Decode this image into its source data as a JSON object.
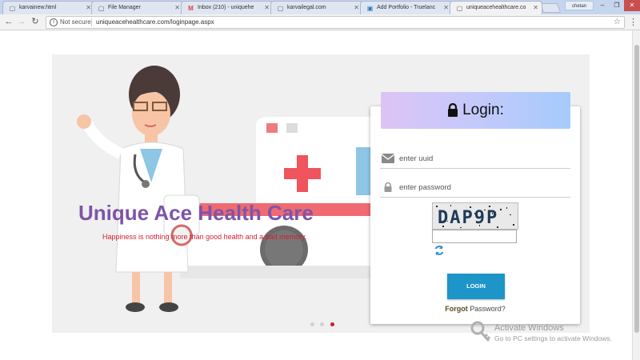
{
  "browser": {
    "tabs": [
      {
        "label": "karvainew.html"
      },
      {
        "label": "File Manager"
      },
      {
        "label": "Inbox (210) - uniquehe"
      },
      {
        "label": "karvailegal.com"
      },
      {
        "label": "Add Portfolio - Truelanc"
      },
      {
        "label": "uniqueacehealthcare.co"
      }
    ],
    "user_label": "chetan",
    "security_label": "Not secure",
    "url": "uniqueacehealthcare.com/loginpage.aspx"
  },
  "hero": {
    "title": "Unique Ace Health Care",
    "tagline": "Happiness is nothing more than good health and a bad memory.",
    "slide_count": 3,
    "active_slide": 3
  },
  "login": {
    "heading": "Login:",
    "uuid_placeholder": "enter uuid",
    "password_placeholder": "enter password",
    "captcha_text": "DAP9P",
    "button_label": "LOGIN",
    "forgot_bold": "Forgot",
    "forgot_rest": " Password?"
  },
  "watermark": {
    "line1": "Activate Windows",
    "line2": "Go to PC settings to activate Windows."
  },
  "colors": {
    "title": "#7d55a8",
    "tagline": "#d21f2f",
    "login_button": "#1e95c8",
    "active_dot": "#cc1f1f"
  }
}
